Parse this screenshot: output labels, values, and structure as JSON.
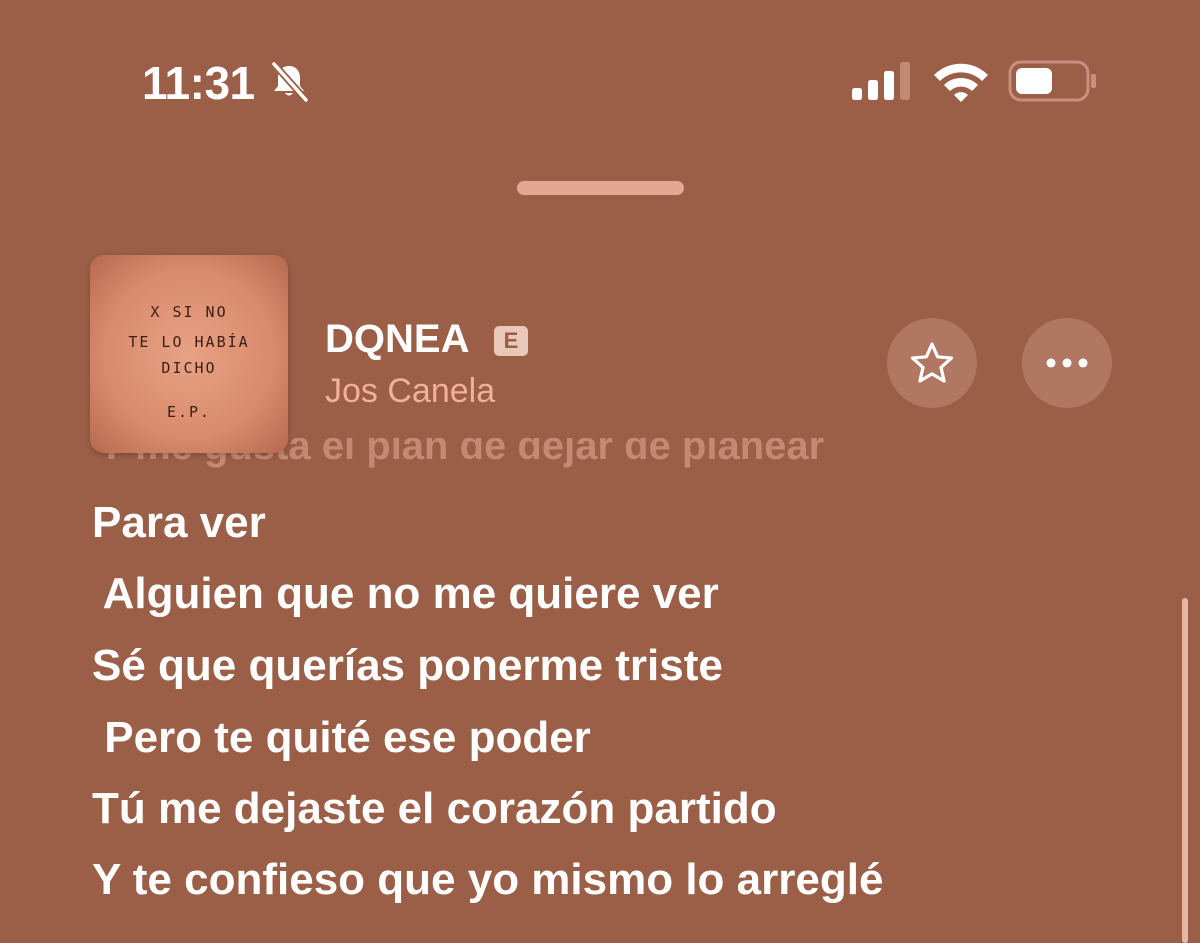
{
  "status_bar": {
    "time": "11:31",
    "mute_icon": "bell-slash-icon",
    "signal_icon": "cellular-signal-icon",
    "wifi_icon": "wifi-icon",
    "battery_icon": "battery-icon"
  },
  "now_playing": {
    "album_art_text": [
      "X SI NO",
      "TE LO HABÍA",
      "DICHO",
      "E.P."
    ],
    "title": "DQNEA",
    "explicit_label": "E",
    "artist": "Jos Canela",
    "favorite_icon": "star-icon",
    "more_icon": "ellipsis-icon"
  },
  "lyrics": {
    "previous_line": "Y me gusta el plan de dejar de planear",
    "lines": [
      "Para ver",
      " Alguien que no me quiere ver",
      "Sé que querías ponerme triste",
      " Pero te quité ese poder",
      "Tú me dejaste el corazón partido",
      "Y te confieso que yo mismo lo arreglé"
    ]
  },
  "colors": {
    "background": "#9b5e47",
    "accent": "#f0b09a",
    "button_background": "#b07763"
  }
}
